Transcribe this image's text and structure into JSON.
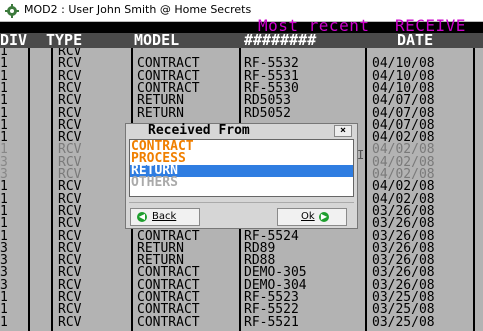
{
  "window": {
    "title": "MOD2 : User John Smith @ Home Secrets",
    "icon": "gear-app-icon"
  },
  "caption": {
    "left": "Most recent",
    "right": "RECEIVE"
  },
  "table": {
    "columns": [
      "DIV",
      "TYPE",
      "MODEL",
      "########",
      "DATE",
      ""
    ],
    "rows": [
      {
        "div": "1",
        "type": "RCV",
        "model": "",
        "num": "",
        "date": ""
      },
      {
        "div": "1",
        "type": "RCV",
        "model": "CONTRACT",
        "num": "RF-5532",
        "date": "04/10/08"
      },
      {
        "div": "1",
        "type": "RCV",
        "model": "CONTRACT",
        "num": "RF-5531",
        "date": "04/10/08"
      },
      {
        "div": "1",
        "type": "RCV",
        "model": "CONTRACT",
        "num": "RF-5530",
        "date": "04/10/08"
      },
      {
        "div": "1",
        "type": "RCV",
        "model": "RETURN",
        "num": "RD5053",
        "date": "04/07/08"
      },
      {
        "div": "1",
        "type": "RCV",
        "model": "RETURN",
        "num": "RD5052",
        "date": "04/07/08"
      },
      {
        "div": "1",
        "type": "RCV",
        "model": "",
        "num": "",
        "date": "04/07/08"
      },
      {
        "div": "1",
        "type": "RCV",
        "model": "",
        "num": "",
        "date": "04/02/08"
      },
      {
        "div": "1",
        "type": "RCV",
        "model": "",
        "num": "",
        "date": "04/02/08",
        "dim": true
      },
      {
        "div": "3",
        "type": "RCV",
        "model": "",
        "num": "",
        "date": "04/02/08",
        "dim": true
      },
      {
        "div": "3",
        "type": "RCV",
        "model": "",
        "num": "",
        "date": "04/02/08",
        "dim": true
      },
      {
        "div": "1",
        "type": "RCV",
        "model": "",
        "num": "",
        "date": "04/02/08"
      },
      {
        "div": "1",
        "type": "RCV",
        "model": "",
        "num": "",
        "date": "04/02/08"
      },
      {
        "div": "1",
        "type": "RCV",
        "model": "",
        "num": "",
        "date": "03/26/08"
      },
      {
        "div": "1",
        "type": "RCV",
        "model": "",
        "num": "",
        "date": "03/26/08"
      },
      {
        "div": "1",
        "type": "RCV",
        "model": "CONTRACT",
        "num": "RF-5524",
        "date": "03/26/08"
      },
      {
        "div": "3",
        "type": "RCV",
        "model": "RETURN",
        "num": "RD89",
        "date": "03/26/08"
      },
      {
        "div": "3",
        "type": "RCV",
        "model": "RETURN",
        "num": "RD88",
        "date": "03/26/08"
      },
      {
        "div": "3",
        "type": "RCV",
        "model": "CONTRACT",
        "num": "DEMO-305",
        "date": "03/26/08"
      },
      {
        "div": "3",
        "type": "RCV",
        "model": "CONTRACT",
        "num": "DEMO-304",
        "date": "03/26/08"
      },
      {
        "div": "1",
        "type": "RCV",
        "model": "CONTRACT",
        "num": "RF-5523",
        "date": "03/25/08"
      },
      {
        "div": "1",
        "type": "RCV",
        "model": "CONTRACT",
        "num": "RF-5522",
        "date": "03/25/08"
      },
      {
        "div": "1",
        "type": "RCV",
        "model": "CONTRACT",
        "num": "RF-5521",
        "date": "03/25/08"
      }
    ]
  },
  "cursor_char": "I",
  "dialog": {
    "title": "Received From",
    "close_label": "×",
    "options": [
      {
        "label": "CONTRACT",
        "color": "#f07f00",
        "selected": false
      },
      {
        "label": "PROCESS",
        "color": "#f07f00",
        "selected": false
      },
      {
        "label": "RETURN",
        "color": "#ffffff",
        "selected": true
      },
      {
        "label": "OTHERS",
        "color": "#aaaaaa",
        "selected": false
      }
    ],
    "back_label": "Back",
    "ok_label": "Ok",
    "back_icon": "arrow-left-icon",
    "ok_icon": "arrow-right-icon"
  },
  "colors": {
    "caption": "#cc00cc",
    "header_bg": "#4a4a4a",
    "grid_bg": "#b3b3b3",
    "selection": "#2f7de1",
    "button_icon": "#1e9e2e"
  }
}
